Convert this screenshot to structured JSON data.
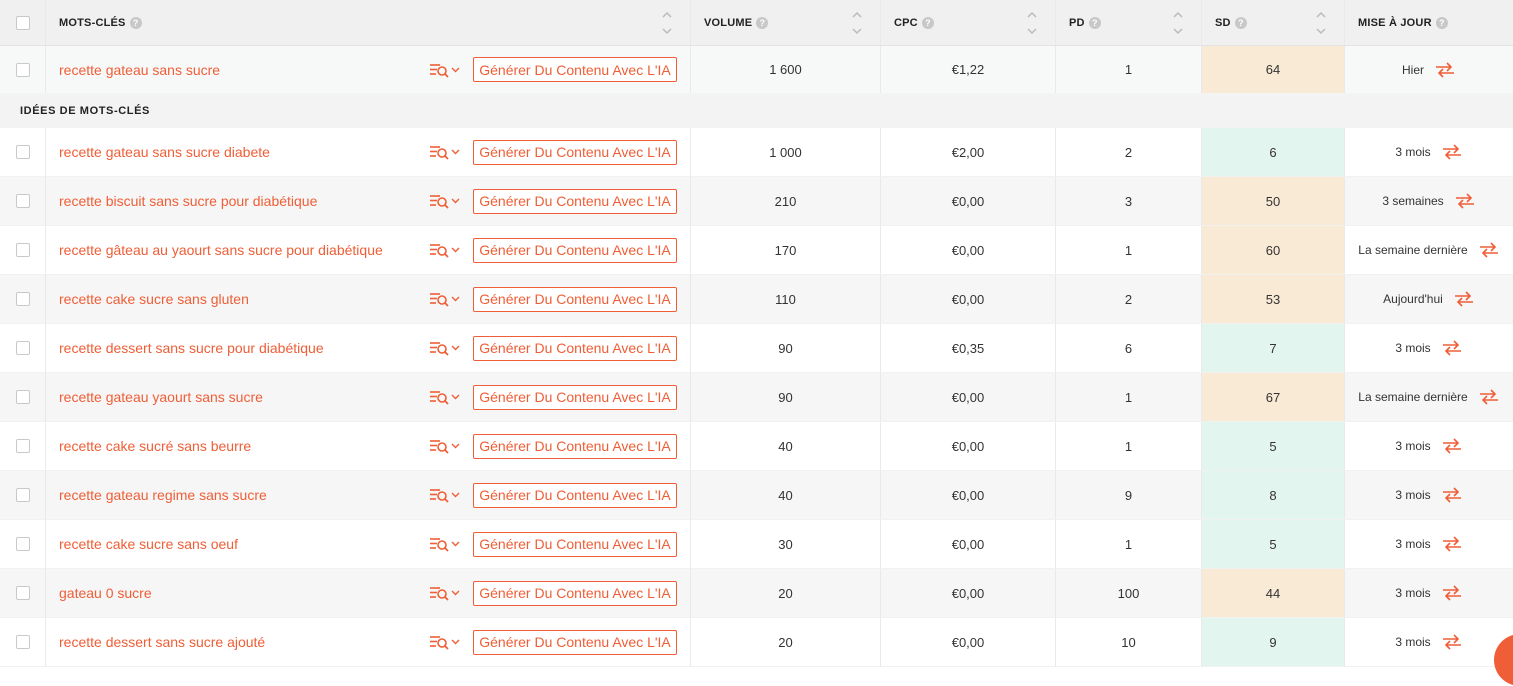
{
  "header": {
    "keywords": "MOTS-CLÉS",
    "volume": "VOLUME",
    "cpc": "CPC",
    "pd": "PD",
    "sd": "SD",
    "updated": "MISE À JOUR",
    "help_glyph": "?"
  },
  "main_row": {
    "keyword": "recette gateau sans sucre",
    "generate": "Générer Du Contenu Avec L'IA",
    "volume": "1 600",
    "cpc": "€1,22",
    "pd": "1",
    "sd": "64",
    "updated": "Hier"
  },
  "section": {
    "label": "IDÉES DE MOTS-CLÉS"
  },
  "ideas": [
    {
      "keyword": "recette gateau sans sucre diabete",
      "generate": "Générer Du Contenu Avec L'IA",
      "volume": "1 000",
      "cpc": "€2,00",
      "pd": "2",
      "sd": "6",
      "updated": "3 mois"
    },
    {
      "keyword": "recette biscuit sans sucre pour diabétique",
      "generate": "Générer Du Contenu Avec L'IA",
      "volume": "210",
      "cpc": "€0,00",
      "pd": "3",
      "sd": "50",
      "updated": "3 semaines"
    },
    {
      "keyword": "recette gâteau au yaourt sans sucre pour diabétique",
      "generate": "Générer Du Contenu Avec L'IA",
      "volume": "170",
      "cpc": "€0,00",
      "pd": "1",
      "sd": "60",
      "updated": "La semaine dernière"
    },
    {
      "keyword": "recette cake sucre sans gluten",
      "generate": "Générer Du Contenu Avec L'IA",
      "volume": "110",
      "cpc": "€0,00",
      "pd": "2",
      "sd": "53",
      "updated": "Aujourd'hui"
    },
    {
      "keyword": "recette dessert sans sucre pour diabétique",
      "generate": "Générer Du Contenu Avec L'IA",
      "volume": "90",
      "cpc": "€0,35",
      "pd": "6",
      "sd": "7",
      "updated": "3 mois"
    },
    {
      "keyword": "recette gateau yaourt sans sucre",
      "generate": "Générer Du Contenu Avec L'IA",
      "volume": "90",
      "cpc": "€0,00",
      "pd": "1",
      "sd": "67",
      "updated": "La semaine dernière"
    },
    {
      "keyword": "recette cake sucré sans beurre",
      "generate": "Générer Du Contenu Avec L'IA",
      "volume": "40",
      "cpc": "€0,00",
      "pd": "1",
      "sd": "5",
      "updated": "3 mois"
    },
    {
      "keyword": "recette gateau regime sans sucre",
      "generate": "Générer Du Contenu Avec L'IA",
      "volume": "40",
      "cpc": "€0,00",
      "pd": "9",
      "sd": "8",
      "updated": "3 mois"
    },
    {
      "keyword": "recette cake sucre sans oeuf",
      "generate": "Générer Du Contenu Avec L'IA",
      "volume": "30",
      "cpc": "€0,00",
      "pd": "1",
      "sd": "5",
      "updated": "3 mois"
    },
    {
      "keyword": "gateau 0 sucre",
      "generate": "Générer Du Contenu Avec L'IA",
      "volume": "20",
      "cpc": "€0,00",
      "pd": "100",
      "sd": "44",
      "updated": "3 mois"
    },
    {
      "keyword": "recette dessert sans sucre ajouté",
      "generate": "Générer Du Contenu Avec L'IA",
      "volume": "20",
      "cpc": "€0,00",
      "pd": "10",
      "sd": "9",
      "updated": "3 mois"
    }
  ],
  "colors": {
    "accent": "#ef5e36",
    "sd_high": "#f9ead6",
    "sd_low": "#e2f5ee"
  },
  "icons": [
    "keyword-search-icon",
    "chevron-down-icon",
    "refresh-icon",
    "sort-icon",
    "help-icon"
  ]
}
